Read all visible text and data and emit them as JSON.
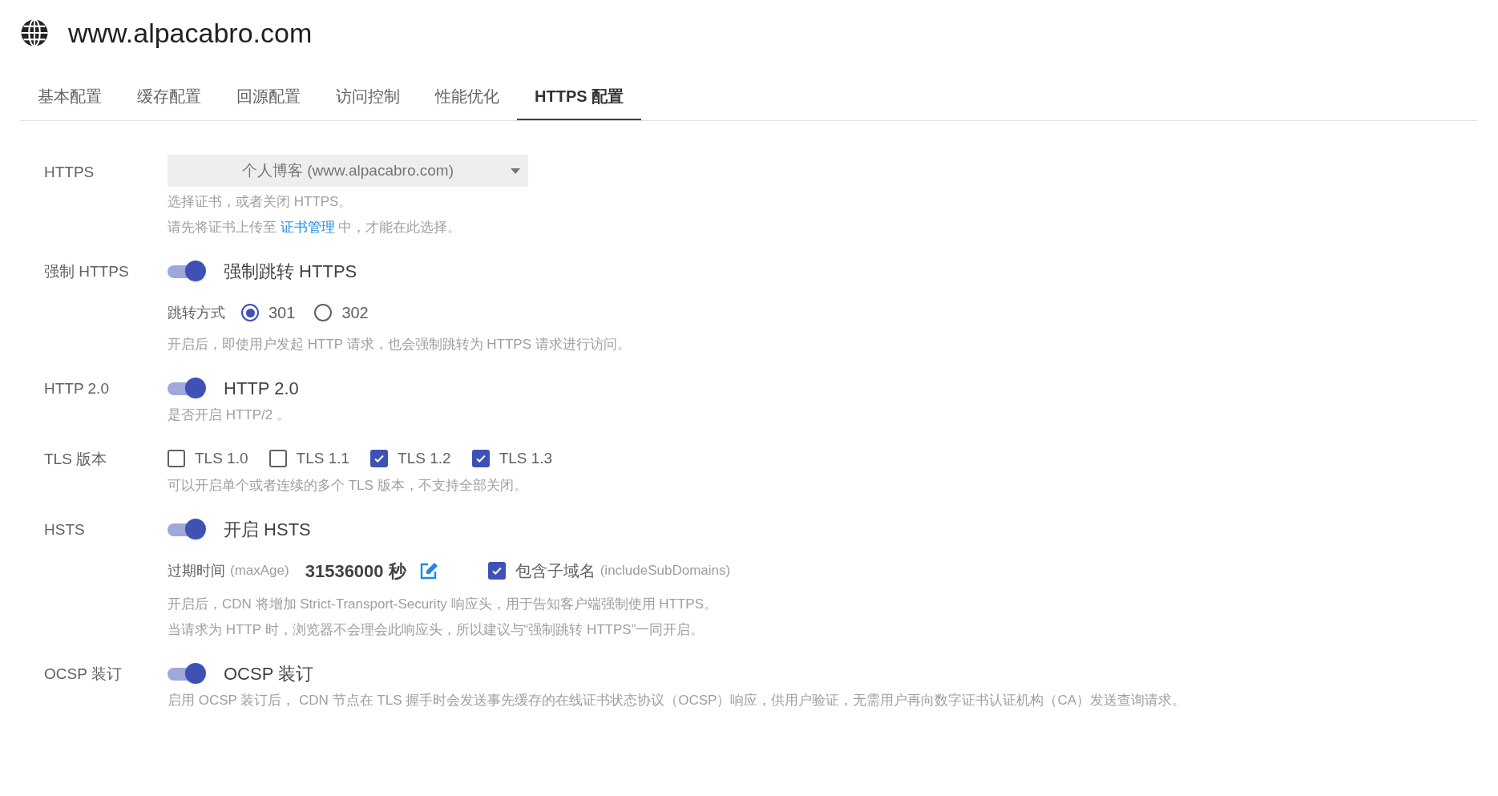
{
  "site": {
    "title": "www.alpacabro.com"
  },
  "tabs": [
    {
      "label": "基本配置",
      "selected": false
    },
    {
      "label": "缓存配置",
      "selected": false
    },
    {
      "label": "回源配置",
      "selected": false
    },
    {
      "label": "访问控制",
      "selected": false
    },
    {
      "label": "性能优化",
      "selected": false
    },
    {
      "label": "HTTPS 配置",
      "selected": true
    }
  ],
  "settings": [
    {
      "kind": "select",
      "label": "HTTPS",
      "value": "个人博客 (www.alpacabro.com)",
      "notes": [
        {
          "text": "选择证书，或者关闭 HTTPS。"
        },
        {
          "text": "请先将证书上传至",
          "link": "证书管理",
          "after": "中，才能在此选择。"
        }
      ]
    },
    {
      "kind": "switch",
      "label": "强制 HTTPS",
      "on": true,
      "switch_label": "强制跳转 HTTPS",
      "radio_group": {
        "label": "跳转方式",
        "options": [
          {
            "label": "301",
            "selected": true
          },
          {
            "label": "302",
            "selected": false
          }
        ]
      },
      "notes": [
        {
          "text": "开启后，即使用户发起 HTTP 请求，也会强制跳转为 HTTPS 请求进行访问。"
        }
      ]
    },
    {
      "kind": "switch",
      "label": "HTTP 2.0",
      "on": true,
      "switch_label": "HTTP 2.0",
      "notes": [
        {
          "text": "是否开启 HTTP/2 。"
        }
      ]
    },
    {
      "kind": "checkboxes",
      "label": "TLS 版本",
      "options": [
        {
          "label": "TLS 1.0",
          "checked": false
        },
        {
          "label": "TLS 1.1",
          "checked": false
        },
        {
          "label": "TLS 1.2",
          "checked": true
        },
        {
          "label": "TLS 1.3",
          "checked": true
        }
      ],
      "notes": [
        {
          "text": "可以开启单个或者连续的多个 TLS 版本，不支持全部关闭。"
        }
      ]
    },
    {
      "kind": "switch",
      "label": "HSTS",
      "on": true,
      "switch_label": "开启 HSTS",
      "max_age": {
        "label": "过期时间",
        "hint": "(maxAge)",
        "value": "31536000 秒"
      },
      "subdomains": {
        "checked": true,
        "label": "包含子域名",
        "hint": "(includeSubDomains)"
      },
      "notes": [
        {
          "text": "开启后，CDN 将增加 Strict-Transport-Security 响应头，用于告知客户端强制使用 HTTPS。"
        },
        {
          "text": "当请求为 HTTP 时，浏览器不会理会此响应头，所以建议与“强制跳转 HTTPS”一同开启。"
        }
      ]
    },
    {
      "kind": "switch",
      "label": "OCSP 装订",
      "on": true,
      "switch_label": "OCSP 装订",
      "notes": [
        {
          "text": "启用 OCSP 装订后， CDN 节点在 TLS 握手时会发送事先缓存的在线证书状态协议（OCSP）响应，供用户验证，无需用户再向数字证书认证机构（CA）发送查询请求。"
        }
      ]
    }
  ]
}
